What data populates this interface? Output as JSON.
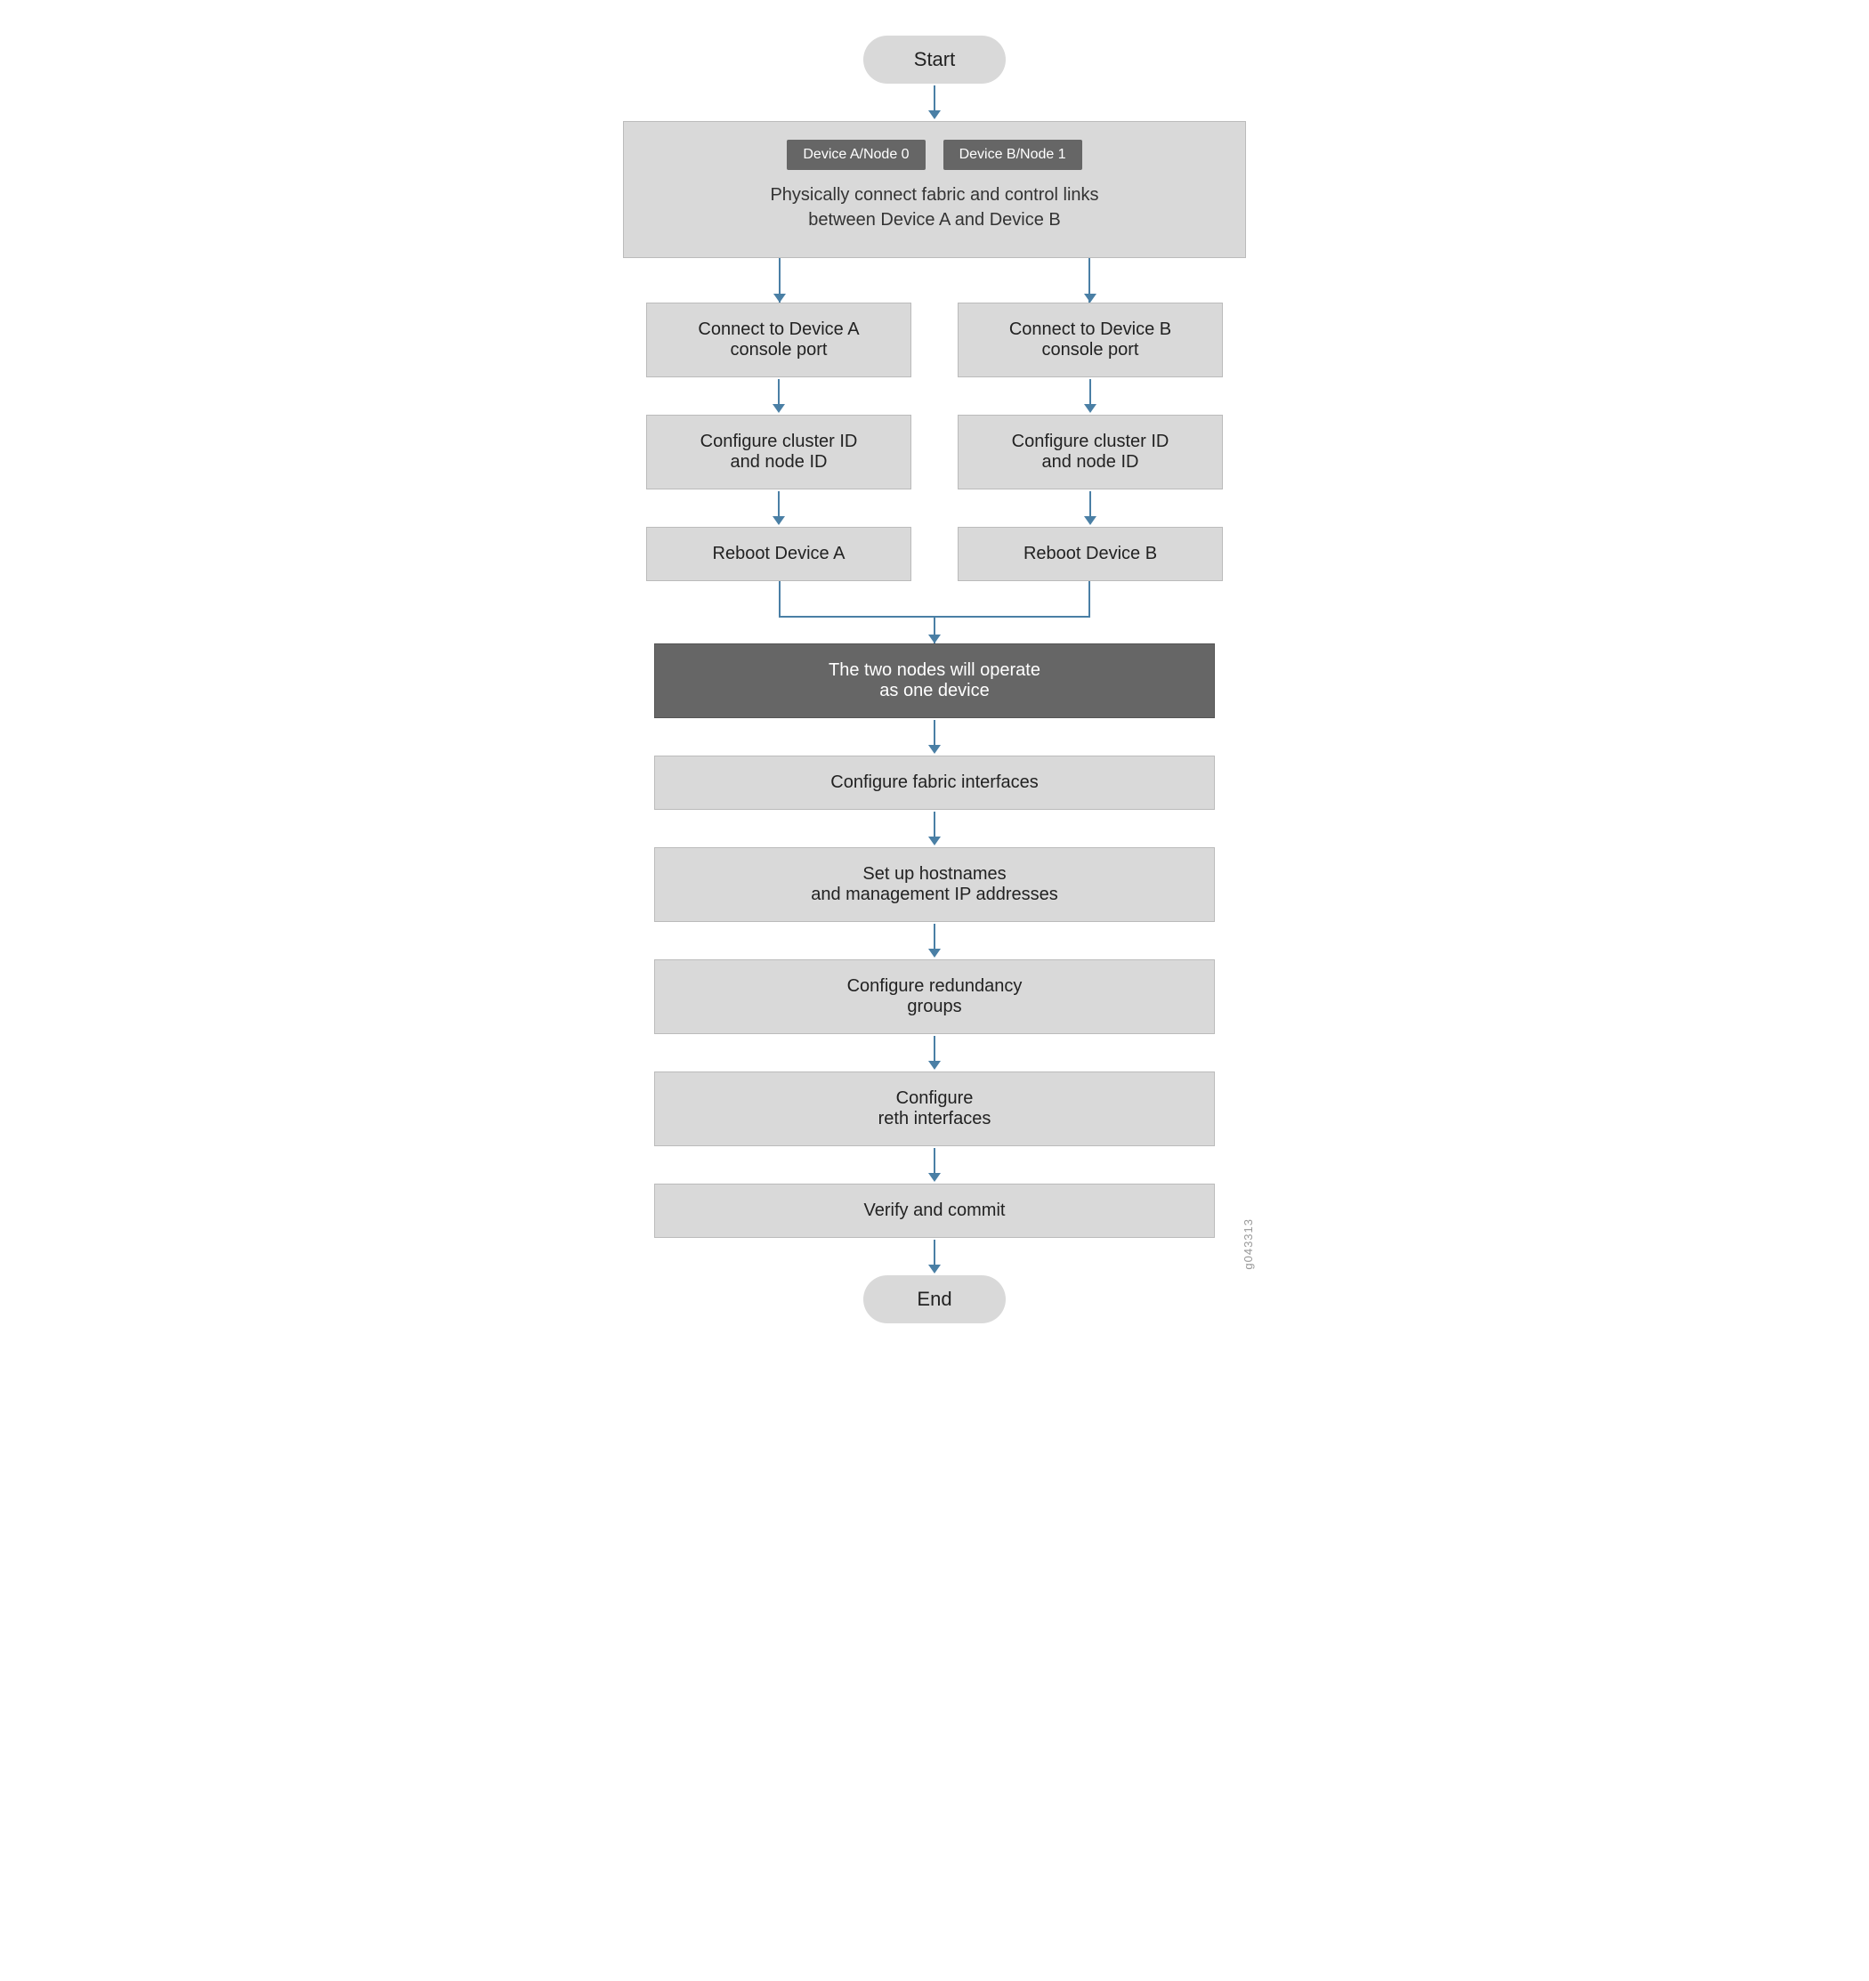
{
  "flowchart": {
    "start_label": "Start",
    "end_label": "End",
    "watermark": "g043313",
    "merged_box": {
      "label_a": "Device A/Node 0",
      "label_b": "Device B/Node 1",
      "text": "Physically connect fabric and control links\nbetween Device A and Device B"
    },
    "left_col": {
      "step1": "Connect to Device A\nconsole port",
      "step2": "Configure cluster ID\nand node ID",
      "step3": "Reboot Device A"
    },
    "right_col": {
      "step1": "Connect to Device B\nconsole port",
      "step2": "Configure cluster ID\nand node ID",
      "step3": "Reboot Device B"
    },
    "unified_steps": [
      "The two nodes will operate\nas one device",
      "Configure fabric interfaces",
      "Set up hostnames\nand management IP addresses",
      "Configure redundancy\ngroups",
      "Configure\nreth interfaces",
      "Verify and commit"
    ]
  }
}
